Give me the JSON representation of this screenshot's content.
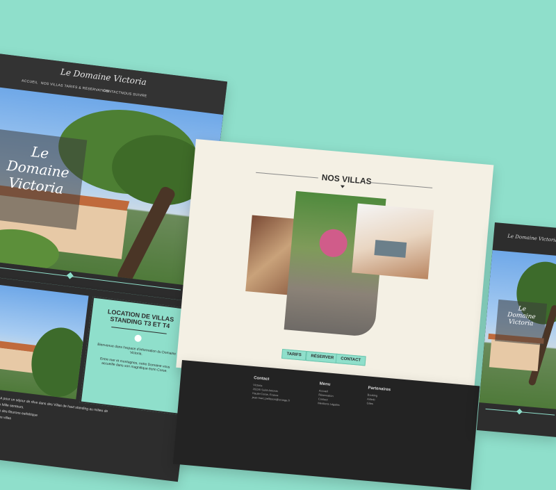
{
  "site": {
    "logo": "Le Domaine Victoria",
    "nav": [
      "ACCUEIL",
      "NOS VILLAS",
      "TARIFS & RESERVATION",
      "CONTACT",
      "NOUS SUIVRE"
    ],
    "hero_title_lines": [
      "Le",
      "Domaine",
      "Victoria"
    ]
  },
  "location_card": {
    "title": "LOCATION DE VILLAS STANDING T3 ET T4",
    "p1": "Bienvenue dans l'espace d'information du Domaine Victoria.",
    "p2": "Entre mer et montagnes, notre Domaine vous accueille dans son magnifique écrin Corse.",
    "body_lines": [
      "Domaine VICTORIA pour un séjour de rêve dans des Villas de haut standing au milieu de",
      "e, dans ce jardin au Mille senteurs.",
      "consistit comme l'un des fleurons esthétique",
      "rmet et de Lozari, nos villas"
    ]
  },
  "villas": {
    "title": "NOS VILLAS",
    "buttons": [
      "TARIFS",
      "RÉSERVER",
      "CONTACT"
    ]
  },
  "footer": {
    "contact_heading": "Contact",
    "contact_lines": [
      "Victoria",
      "20226 Saint-Antonin",
      "Haute-Corse, France",
      "jean-marc.pellisson@orange.fr"
    ],
    "menu_heading": "Menu",
    "menu_items": [
      "Accueil",
      "Réservation",
      "Contact",
      "Mentions Légales"
    ],
    "partners_heading": "Partenaires",
    "partners_items": [
      "Booking",
      "Airbnb",
      "Gites"
    ]
  },
  "colors": {
    "mint": "#8fdfcb",
    "dark": "#2d2d2d",
    "cream": "#f4f0e4"
  }
}
